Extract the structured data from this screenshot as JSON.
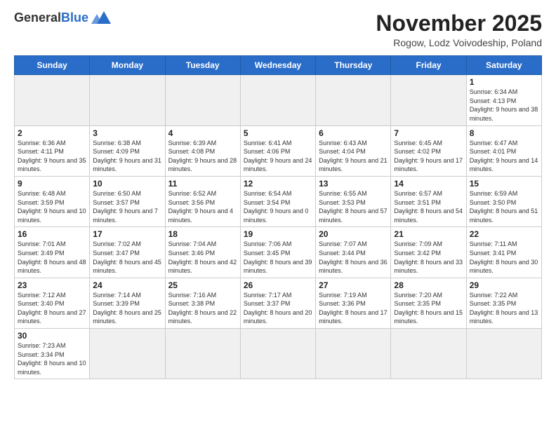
{
  "header": {
    "logo_general": "General",
    "logo_blue": "Blue",
    "title": "November 2025",
    "subtitle": "Rogow, Lodz Voivodeship, Poland"
  },
  "days_of_week": [
    "Sunday",
    "Monday",
    "Tuesday",
    "Wednesday",
    "Thursday",
    "Friday",
    "Saturday"
  ],
  "weeks": [
    [
      {
        "day": "",
        "info": "",
        "empty": true
      },
      {
        "day": "",
        "info": "",
        "empty": true
      },
      {
        "day": "",
        "info": "",
        "empty": true
      },
      {
        "day": "",
        "info": "",
        "empty": true
      },
      {
        "day": "",
        "info": "",
        "empty": true
      },
      {
        "day": "",
        "info": "",
        "empty": true
      },
      {
        "day": "1",
        "info": "Sunrise: 6:34 AM\nSunset: 4:13 PM\nDaylight: 9 hours\nand 38 minutes.",
        "empty": false
      }
    ],
    [
      {
        "day": "2",
        "info": "Sunrise: 6:36 AM\nSunset: 4:11 PM\nDaylight: 9 hours\nand 35 minutes.",
        "empty": false
      },
      {
        "day": "3",
        "info": "Sunrise: 6:38 AM\nSunset: 4:09 PM\nDaylight: 9 hours\nand 31 minutes.",
        "empty": false
      },
      {
        "day": "4",
        "info": "Sunrise: 6:39 AM\nSunset: 4:08 PM\nDaylight: 9 hours\nand 28 minutes.",
        "empty": false
      },
      {
        "day": "5",
        "info": "Sunrise: 6:41 AM\nSunset: 4:06 PM\nDaylight: 9 hours\nand 24 minutes.",
        "empty": false
      },
      {
        "day": "6",
        "info": "Sunrise: 6:43 AM\nSunset: 4:04 PM\nDaylight: 9 hours\nand 21 minutes.",
        "empty": false
      },
      {
        "day": "7",
        "info": "Sunrise: 6:45 AM\nSunset: 4:02 PM\nDaylight: 9 hours\nand 17 minutes.",
        "empty": false
      },
      {
        "day": "8",
        "info": "Sunrise: 6:47 AM\nSunset: 4:01 PM\nDaylight: 9 hours\nand 14 minutes.",
        "empty": false
      }
    ],
    [
      {
        "day": "9",
        "info": "Sunrise: 6:48 AM\nSunset: 3:59 PM\nDaylight: 9 hours\nand 10 minutes.",
        "empty": false
      },
      {
        "day": "10",
        "info": "Sunrise: 6:50 AM\nSunset: 3:57 PM\nDaylight: 9 hours\nand 7 minutes.",
        "empty": false
      },
      {
        "day": "11",
        "info": "Sunrise: 6:52 AM\nSunset: 3:56 PM\nDaylight: 9 hours\nand 4 minutes.",
        "empty": false
      },
      {
        "day": "12",
        "info": "Sunrise: 6:54 AM\nSunset: 3:54 PM\nDaylight: 9 hours\nand 0 minutes.",
        "empty": false
      },
      {
        "day": "13",
        "info": "Sunrise: 6:55 AM\nSunset: 3:53 PM\nDaylight: 8 hours\nand 57 minutes.",
        "empty": false
      },
      {
        "day": "14",
        "info": "Sunrise: 6:57 AM\nSunset: 3:51 PM\nDaylight: 8 hours\nand 54 minutes.",
        "empty": false
      },
      {
        "day": "15",
        "info": "Sunrise: 6:59 AM\nSunset: 3:50 PM\nDaylight: 8 hours\nand 51 minutes.",
        "empty": false
      }
    ],
    [
      {
        "day": "16",
        "info": "Sunrise: 7:01 AM\nSunset: 3:49 PM\nDaylight: 8 hours\nand 48 minutes.",
        "empty": false
      },
      {
        "day": "17",
        "info": "Sunrise: 7:02 AM\nSunset: 3:47 PM\nDaylight: 8 hours\nand 45 minutes.",
        "empty": false
      },
      {
        "day": "18",
        "info": "Sunrise: 7:04 AM\nSunset: 3:46 PM\nDaylight: 8 hours\nand 42 minutes.",
        "empty": false
      },
      {
        "day": "19",
        "info": "Sunrise: 7:06 AM\nSunset: 3:45 PM\nDaylight: 8 hours\nand 39 minutes.",
        "empty": false
      },
      {
        "day": "20",
        "info": "Sunrise: 7:07 AM\nSunset: 3:44 PM\nDaylight: 8 hours\nand 36 minutes.",
        "empty": false
      },
      {
        "day": "21",
        "info": "Sunrise: 7:09 AM\nSunset: 3:42 PM\nDaylight: 8 hours\nand 33 minutes.",
        "empty": false
      },
      {
        "day": "22",
        "info": "Sunrise: 7:11 AM\nSunset: 3:41 PM\nDaylight: 8 hours\nand 30 minutes.",
        "empty": false
      }
    ],
    [
      {
        "day": "23",
        "info": "Sunrise: 7:12 AM\nSunset: 3:40 PM\nDaylight: 8 hours\nand 27 minutes.",
        "empty": false
      },
      {
        "day": "24",
        "info": "Sunrise: 7:14 AM\nSunset: 3:39 PM\nDaylight: 8 hours\nand 25 minutes.",
        "empty": false
      },
      {
        "day": "25",
        "info": "Sunrise: 7:16 AM\nSunset: 3:38 PM\nDaylight: 8 hours\nand 22 minutes.",
        "empty": false
      },
      {
        "day": "26",
        "info": "Sunrise: 7:17 AM\nSunset: 3:37 PM\nDaylight: 8 hours\nand 20 minutes.",
        "empty": false
      },
      {
        "day": "27",
        "info": "Sunrise: 7:19 AM\nSunset: 3:36 PM\nDaylight: 8 hours\nand 17 minutes.",
        "empty": false
      },
      {
        "day": "28",
        "info": "Sunrise: 7:20 AM\nSunset: 3:35 PM\nDaylight: 8 hours\nand 15 minutes.",
        "empty": false
      },
      {
        "day": "29",
        "info": "Sunrise: 7:22 AM\nSunset: 3:35 PM\nDaylight: 8 hours\nand 13 minutes.",
        "empty": false
      }
    ],
    [
      {
        "day": "30",
        "info": "Sunrise: 7:23 AM\nSunset: 3:34 PM\nDaylight: 8 hours\nand 10 minutes.",
        "empty": false
      },
      {
        "day": "",
        "info": "",
        "empty": true
      },
      {
        "day": "",
        "info": "",
        "empty": true
      },
      {
        "day": "",
        "info": "",
        "empty": true
      },
      {
        "day": "",
        "info": "",
        "empty": true
      },
      {
        "day": "",
        "info": "",
        "empty": true
      },
      {
        "day": "",
        "info": "",
        "empty": true
      }
    ]
  ]
}
